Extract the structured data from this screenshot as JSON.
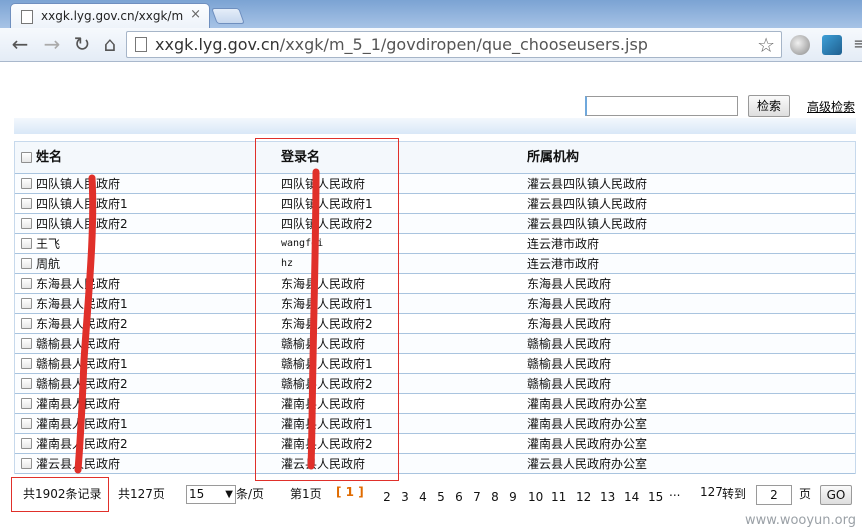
{
  "browser": {
    "tab_title": "xxgk.lyg.gov.cn/xxgk/m",
    "tab_close": "×",
    "url_host": "xxgk.lyg.gov.cn",
    "url_path": "/xxgk/m_5_1/govdiropen/que_chooseusers.jsp"
  },
  "search": {
    "value": "",
    "button_label": "检索",
    "advanced_label": "高级检索"
  },
  "table": {
    "headers": [
      "姓名",
      "登录名",
      "所属机构"
    ],
    "rows": [
      [
        "四队镇人民政府",
        "四队镇人民政府",
        "灌云县四队镇人民政府"
      ],
      [
        "四队镇人民政府1",
        "四队镇人民政府1",
        "灌云县四队镇人民政府"
      ],
      [
        "四队镇人民政府2",
        "四队镇人民政府2",
        "灌云县四队镇人民政府"
      ],
      [
        "王飞",
        "wangfei",
        "连云港市政府"
      ],
      [
        "周航",
        "hz",
        "连云港市政府"
      ],
      [
        "东海县人民政府",
        "东海县人民政府",
        "东海县人民政府"
      ],
      [
        "东海县人民政府1",
        "东海县人民政府1",
        "东海县人民政府"
      ],
      [
        "东海县人民政府2",
        "东海县人民政府2",
        "东海县人民政府"
      ],
      [
        "赣榆县人民政府",
        "赣榆县人民政府",
        "赣榆县人民政府"
      ],
      [
        "赣榆县人民政府1",
        "赣榆县人民政府1",
        "赣榆县人民政府"
      ],
      [
        "赣榆县人民政府2",
        "赣榆县人民政府2",
        "赣榆县人民政府"
      ],
      [
        "灌南县人民政府",
        "灌南县人民政府",
        "灌南县人民政府办公室"
      ],
      [
        "灌南县人民政府1",
        "灌南县人民政府1",
        "灌南县人民政府办公室"
      ],
      [
        "灌南县人民政府2",
        "灌南县人民政府2",
        "灌南县人民政府办公室"
      ],
      [
        "灌云县人民政府",
        "灌云县人民政府",
        "灌云县人民政府办公室"
      ]
    ]
  },
  "pager": {
    "total_records": "共1902条记录",
    "total_pages": "共127页",
    "page_size": "15",
    "page_size_arrow": "▼",
    "per_page_label": "条/页",
    "current_page_text": "第1页",
    "current_page": "[ 1 ]",
    "pages": [
      "2",
      "3",
      "4",
      "5",
      "6",
      "7",
      "8",
      "9",
      "10",
      "11",
      "12",
      "13",
      "14",
      "15"
    ],
    "ellipsis": "...",
    "last_page": "127",
    "goto_label": "转到",
    "goto_value": "2",
    "page_unit": "页",
    "go_label": "GO"
  },
  "watermark": "www.wooyun.org",
  "colors": {
    "annotation": "#e0302a",
    "current_page": "#e06b00",
    "table_border": "#a9c4df"
  }
}
